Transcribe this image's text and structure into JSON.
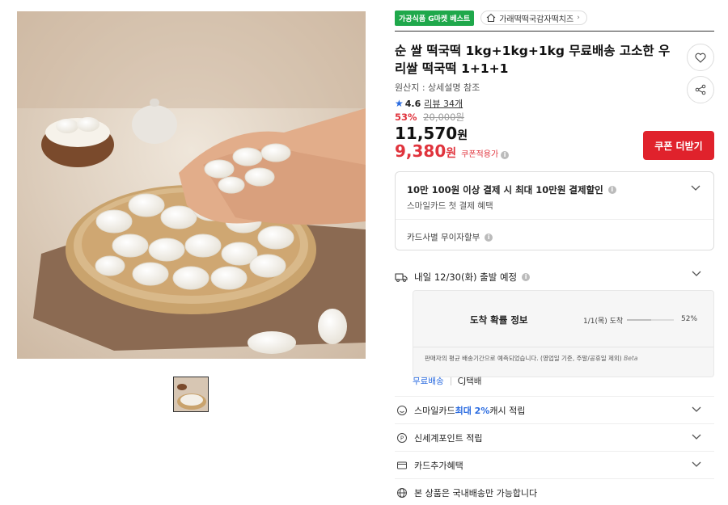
{
  "badges": {
    "category_badge": "가공식품 G마켓 베스트",
    "shop_name": "가래떡떡국감자떡치즈"
  },
  "product": {
    "title": "순 쌀 떡국떡 1kg+1kg+1kg 무료배송 고소한 우리쌀 떡국떡 1+1+1",
    "origin": "원산지 : 상세설명 참조",
    "rating": "4.6",
    "reviews": "리뷰 34개",
    "discount_pct": "53%",
    "original_price": "20,000원",
    "price_num": "11,570",
    "price_unit": "원",
    "coupon_price_num": "9,380",
    "coupon_price_unit": "원",
    "coupon_tag": "쿠폰적용가",
    "coupon_button": "쿠폰 더받기"
  },
  "benefit": {
    "title": "10만 100원 이상 결제 시 최대 10만원 결제할인",
    "subtitle": "스마일카드 첫 결제 혜택",
    "installment": "카드사별 무이자할부"
  },
  "shipping": {
    "departure": "내일 12/30(화) 출발 예정",
    "arrival_title": "도착 확률 정보",
    "arrival_day": "1/1(목) 도착",
    "arrival_pct_label": "52%",
    "arrival_pct_value": 0.52,
    "note": "판매자의 평균 배송기간으로 예측되었습니다. (영업일 기준, 주말/공휴일 제외)",
    "beta": "Beta",
    "free_shipping": "무료배송",
    "carrier": "CJ택배"
  },
  "rows": {
    "smile_prefix": "스마일카드 ",
    "smile_highlight": "최대 2%",
    "smile_suffix": " 캐시 적립",
    "shinsegae": "신세계포인트 적립",
    "card_benefit": "카드추가혜택",
    "domestic": "본 상품은 국내배송만 가능합니다"
  },
  "colors": {
    "accent_red": "#e0222c",
    "badge_green": "#1fa84b",
    "link_blue": "#2a6be0"
  }
}
